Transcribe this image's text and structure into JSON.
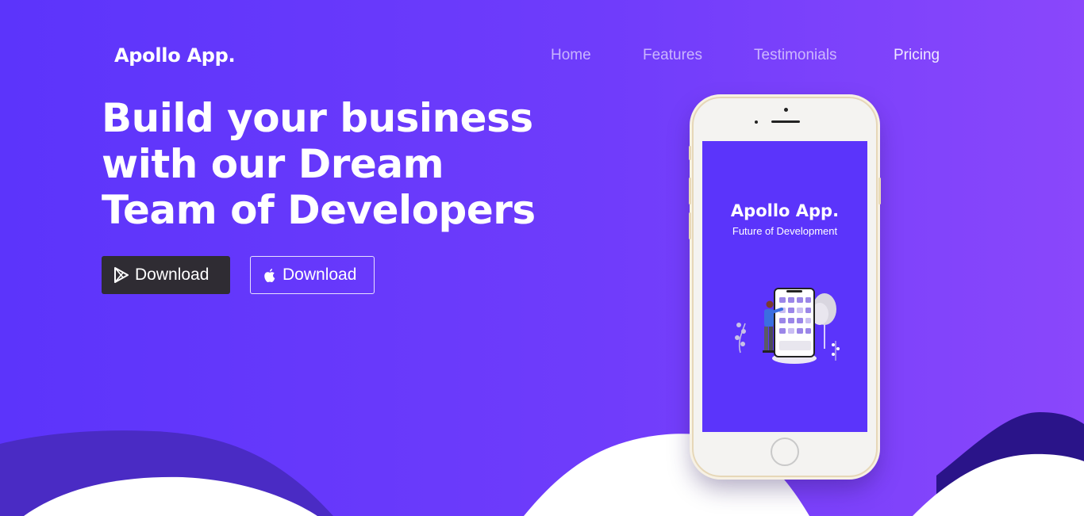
{
  "brand": {
    "name": "Apollo App."
  },
  "nav": {
    "items": [
      {
        "label": "Home"
      },
      {
        "label": "Features"
      },
      {
        "label": "Testimonials"
      },
      {
        "label": "Pricing"
      }
    ]
  },
  "hero": {
    "headline_lines": [
      "Build your business",
      "with our Dream",
      "Team of Developers"
    ],
    "buttons": [
      {
        "label": "Download",
        "icon": "google-play-icon"
      },
      {
        "label": "Download",
        "icon": "apple-icon"
      }
    ]
  },
  "phone_screen": {
    "title": "Apollo App.",
    "subtitle": "Future of Development",
    "illustration": "developer-with-phone-illustration"
  },
  "colors": {
    "background_start": "#5c34fb",
    "background_end": "#8a47fb",
    "dark_button": "#2f2c33",
    "wave_dark": "#4a2bc4",
    "wave_navy": "#2a1489",
    "white": "#ffffff"
  }
}
